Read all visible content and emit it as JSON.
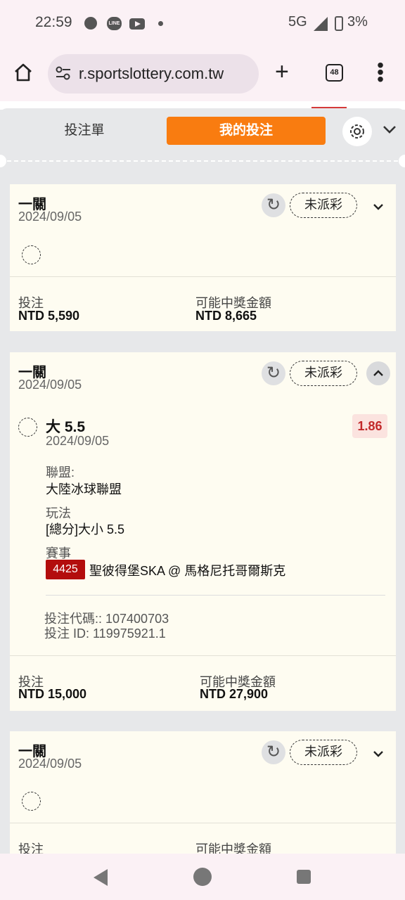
{
  "status_bar": {
    "time": "22:59",
    "network": "5G",
    "battery": "3%",
    "line_label": "LINE"
  },
  "browser": {
    "url": "r.sportslottery.com.tw",
    "tab_count": "48"
  },
  "betslip": {
    "tab_betslip": "投注單",
    "tab_mybets": "我的投注"
  },
  "bets": [
    {
      "kind": "一關",
      "date": "2024/09/05",
      "status": "未派彩",
      "stake_label": "投注",
      "stake": "NTD 5,590",
      "payout_label": "可能中獎金額",
      "payout": "NTD 8,665"
    },
    {
      "kind": "一關",
      "date": "2024/09/05",
      "status": "未派彩",
      "selection": {
        "title": "大 5.5",
        "date": "2024/09/05",
        "odds": "1.86",
        "league_label": "聯盟:",
        "league": "大陸冰球聯盟",
        "market_label": "玩法",
        "market": "[總分]大小 5.5",
        "event_label": "賽事",
        "event_code": "4425",
        "event_name": "聖彼得堡SKA @ 馬格尼托哥爾斯克",
        "bet_code": "投注代碼:: 107400703",
        "bet_id": "投注 ID: 119975921.1"
      },
      "stake_label": "投注",
      "stake": "NTD 15,000",
      "payout_label": "可能中獎金額",
      "payout": "NTD 27,900"
    },
    {
      "kind": "一關",
      "date": "2024/09/05",
      "status": "未派彩",
      "stake_label": "投注",
      "payout_label": "可能中獎金額"
    }
  ],
  "icons": {
    "home": "home-icon",
    "tune": "tune-icon",
    "plus": "plus-icon",
    "tabs": "tabs-icon",
    "menu": "more-vert-icon",
    "gear": "gear-icon",
    "refresh": "refresh-icon",
    "chevron_down": "chevron-down-icon",
    "chevron_up": "chevron-up-icon"
  },
  "colors": {
    "accent": "#f97c10",
    "odds_text": "#c22a2a",
    "event_badge": "#b30d0d",
    "card_bg": "#fefcf1"
  }
}
